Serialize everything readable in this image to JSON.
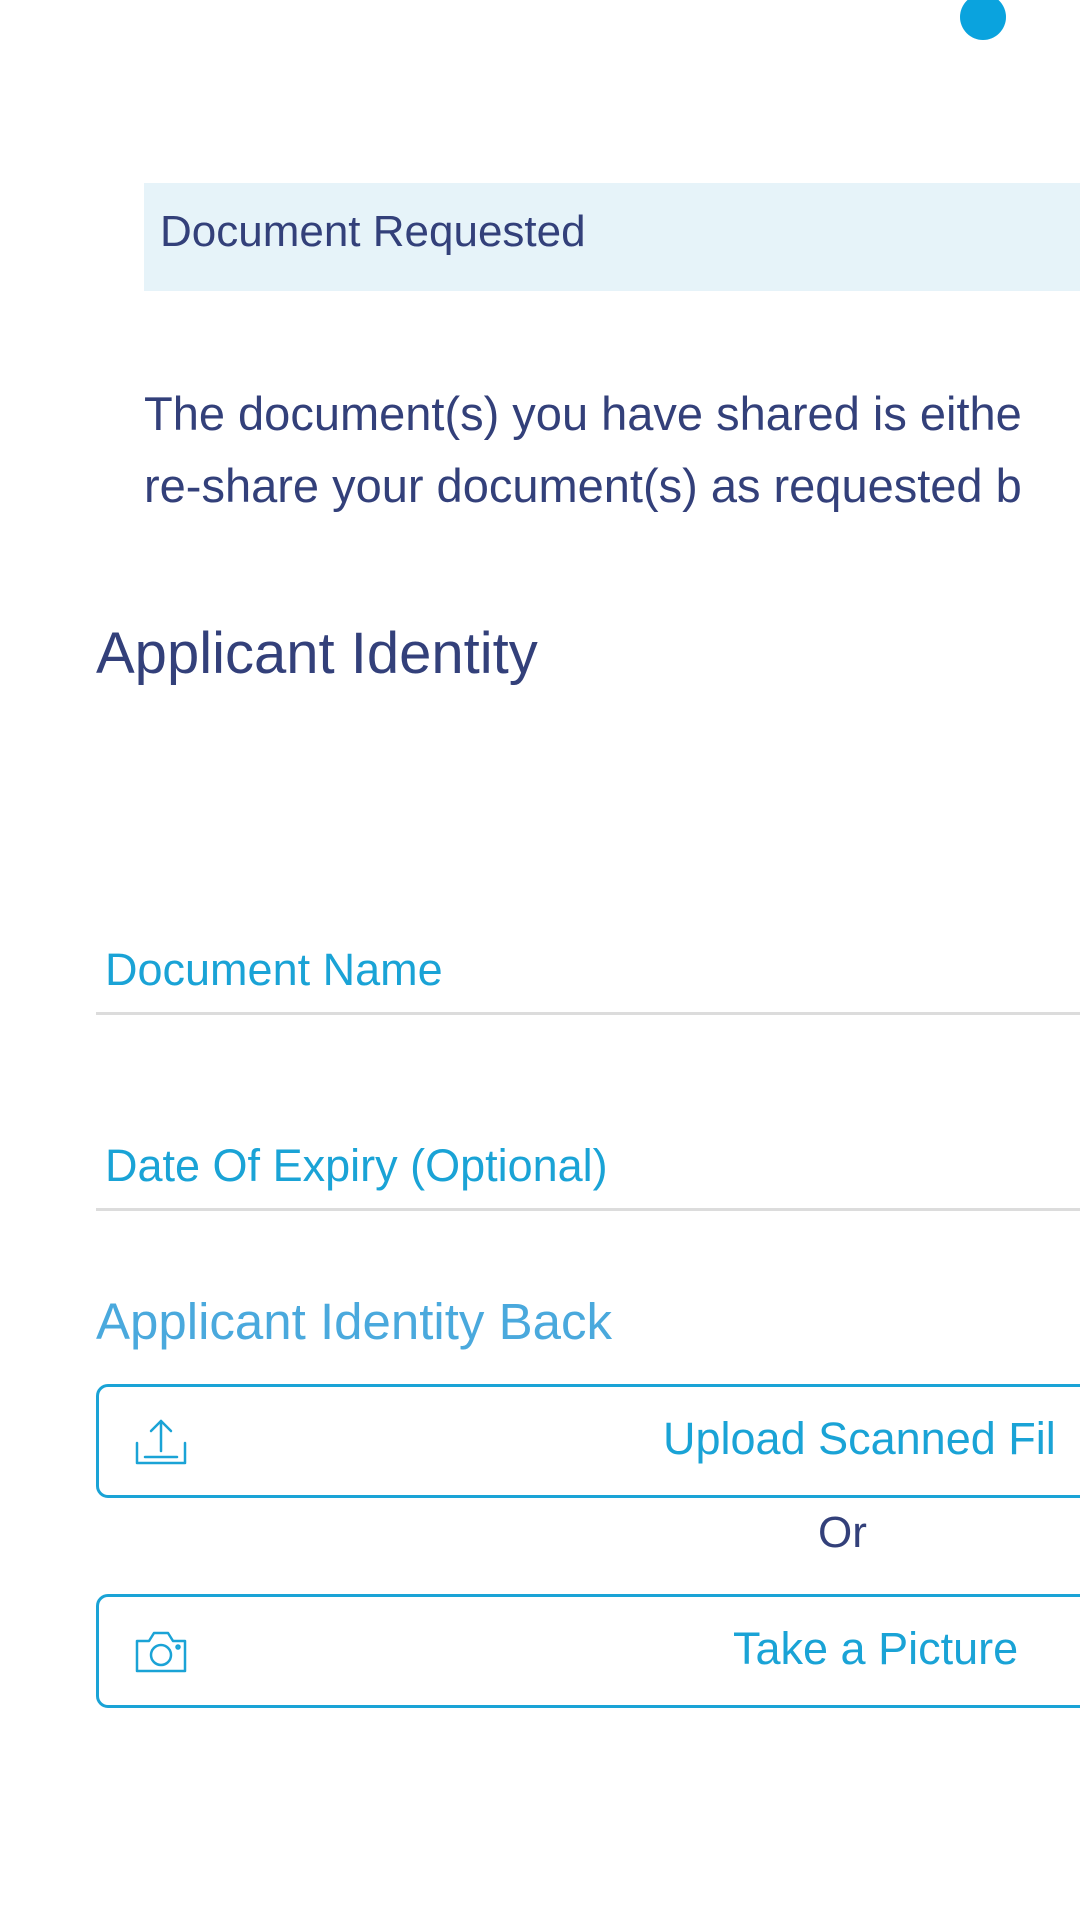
{
  "banner": {
    "title": "Document Requested"
  },
  "message": {
    "line1": "The document(s) you have shared is eithe",
    "line2": "re-share your document(s) as requested b"
  },
  "section": {
    "title": "Applicant Identity"
  },
  "fields": {
    "document_name_label": "Document Name",
    "date_of_expiry_label": "Date Of Expiry (Optional)"
  },
  "subsection": {
    "title": "Applicant Identity Back"
  },
  "actions": {
    "upload_label": "Upload Scanned Fil",
    "upload_icon": "upload-icon",
    "or_text": "Or",
    "picture_label": "Take a Picture",
    "picture_icon": "camera-icon"
  },
  "colors": {
    "accent": "#1aa3d6",
    "primary_text": "#33407a",
    "banner_background": "#e6f3f9",
    "indicator_dot": "#0aa3de"
  }
}
